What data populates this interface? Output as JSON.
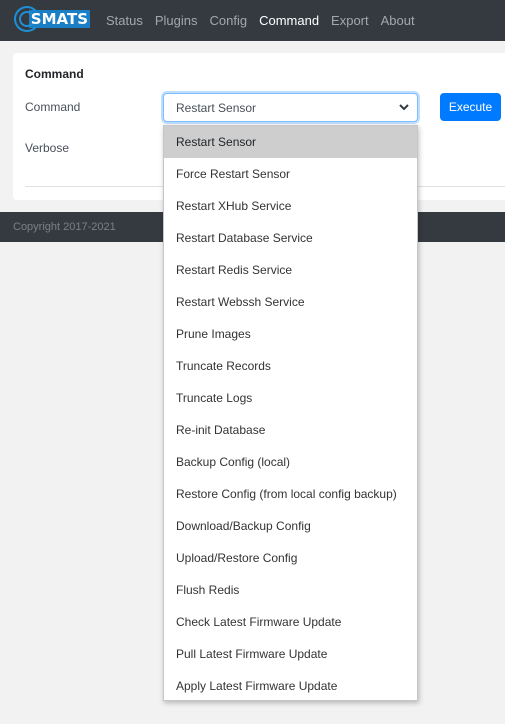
{
  "brand": {
    "logo_text": "SMATS"
  },
  "nav": {
    "items": [
      "Status",
      "Plugins",
      "Config",
      "Command",
      "Export",
      "About"
    ],
    "active": "Command"
  },
  "card": {
    "title": "Command",
    "command_label": "Command",
    "verbose_label": "Verbose",
    "selected_value": "Restart Sensor",
    "execute_label": "Execute"
  },
  "footer": {
    "copyright": "Copyright 2017-2021"
  },
  "dropdown": {
    "options": [
      "Restart Sensor",
      "Force Restart Sensor",
      "Restart XHub Service",
      "Restart Database Service",
      "Restart Redis Service",
      "Restart Webssh Service",
      "Prune Images",
      "Truncate Records",
      "Truncate Logs",
      "Re-init Database",
      "Backup Config (local)",
      "Restore Config (from local config backup)",
      "Download/Backup Config",
      "Upload/Restore Config",
      "Flush Redis",
      "Check Latest Firmware Update",
      "Pull Latest Firmware Update",
      "Apply Latest Firmware Update"
    ],
    "highlighted": "Restart Sensor"
  },
  "colors": {
    "navbar": "#343a40",
    "primary": "#007bff",
    "brand": "#1e8fd6",
    "highlight": "#cecece"
  }
}
